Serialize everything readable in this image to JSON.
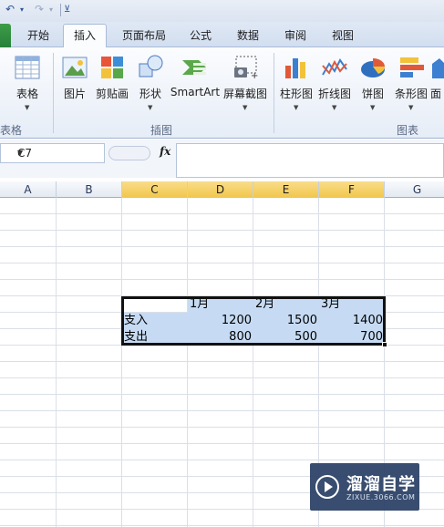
{
  "quick_access": {
    "undo": "↶",
    "redo": "↷",
    "dropdown": "▾",
    "customize": "⊻"
  },
  "tabs": [
    {
      "label": "开始"
    },
    {
      "label": "插入",
      "active": true
    },
    {
      "label": "页面布局"
    },
    {
      "label": "公式"
    },
    {
      "label": "数据"
    },
    {
      "label": "审阅"
    },
    {
      "label": "视图"
    }
  ],
  "ribbon": {
    "table_group": {
      "button": "表格",
      "group_label": "表格"
    },
    "illustrations": {
      "buttons": [
        {
          "label": "图片",
          "icon": "picture-icon"
        },
        {
          "label": "剪贴画",
          "icon": "clipart-icon"
        },
        {
          "label": "形状",
          "icon": "shapes-icon"
        },
        {
          "label": "SmartArt",
          "icon": "smartart-icon"
        },
        {
          "label": "屏幕截图",
          "icon": "screenshot-icon"
        }
      ],
      "group_label": "插图"
    },
    "charts": {
      "buttons": [
        {
          "label": "柱形图",
          "icon": "column-chart-icon"
        },
        {
          "label": "折线图",
          "icon": "line-chart-icon"
        },
        {
          "label": "饼图",
          "icon": "pie-chart-icon"
        },
        {
          "label": "条形图",
          "icon": "bar-chart-icon"
        },
        {
          "label": "面",
          "icon": "area-chart-icon"
        }
      ],
      "group_label": "图表"
    }
  },
  "formula_bar": {
    "name_box": "C7",
    "fx": "fx",
    "content": ""
  },
  "columns": [
    "A",
    "B",
    "C",
    "D",
    "E",
    "F",
    "G"
  ],
  "selected_columns": [
    "C",
    "D",
    "E",
    "F"
  ],
  "table": {
    "headers": [
      "",
      "1月",
      "2月",
      "3月"
    ],
    "rows": [
      {
        "label": "支入",
        "values": [
          "1200",
          "1500",
          "1400"
        ]
      },
      {
        "label": "支出",
        "values": [
          "800",
          "500",
          "700"
        ]
      }
    ]
  },
  "watermark": {
    "title": "溜溜自学",
    "url": "ZIXUE.3066.COM"
  },
  "colors": {
    "accent": "#2b5797",
    "selected_header": "#f1c64b",
    "selection_fill": "#c6dbf3"
  }
}
